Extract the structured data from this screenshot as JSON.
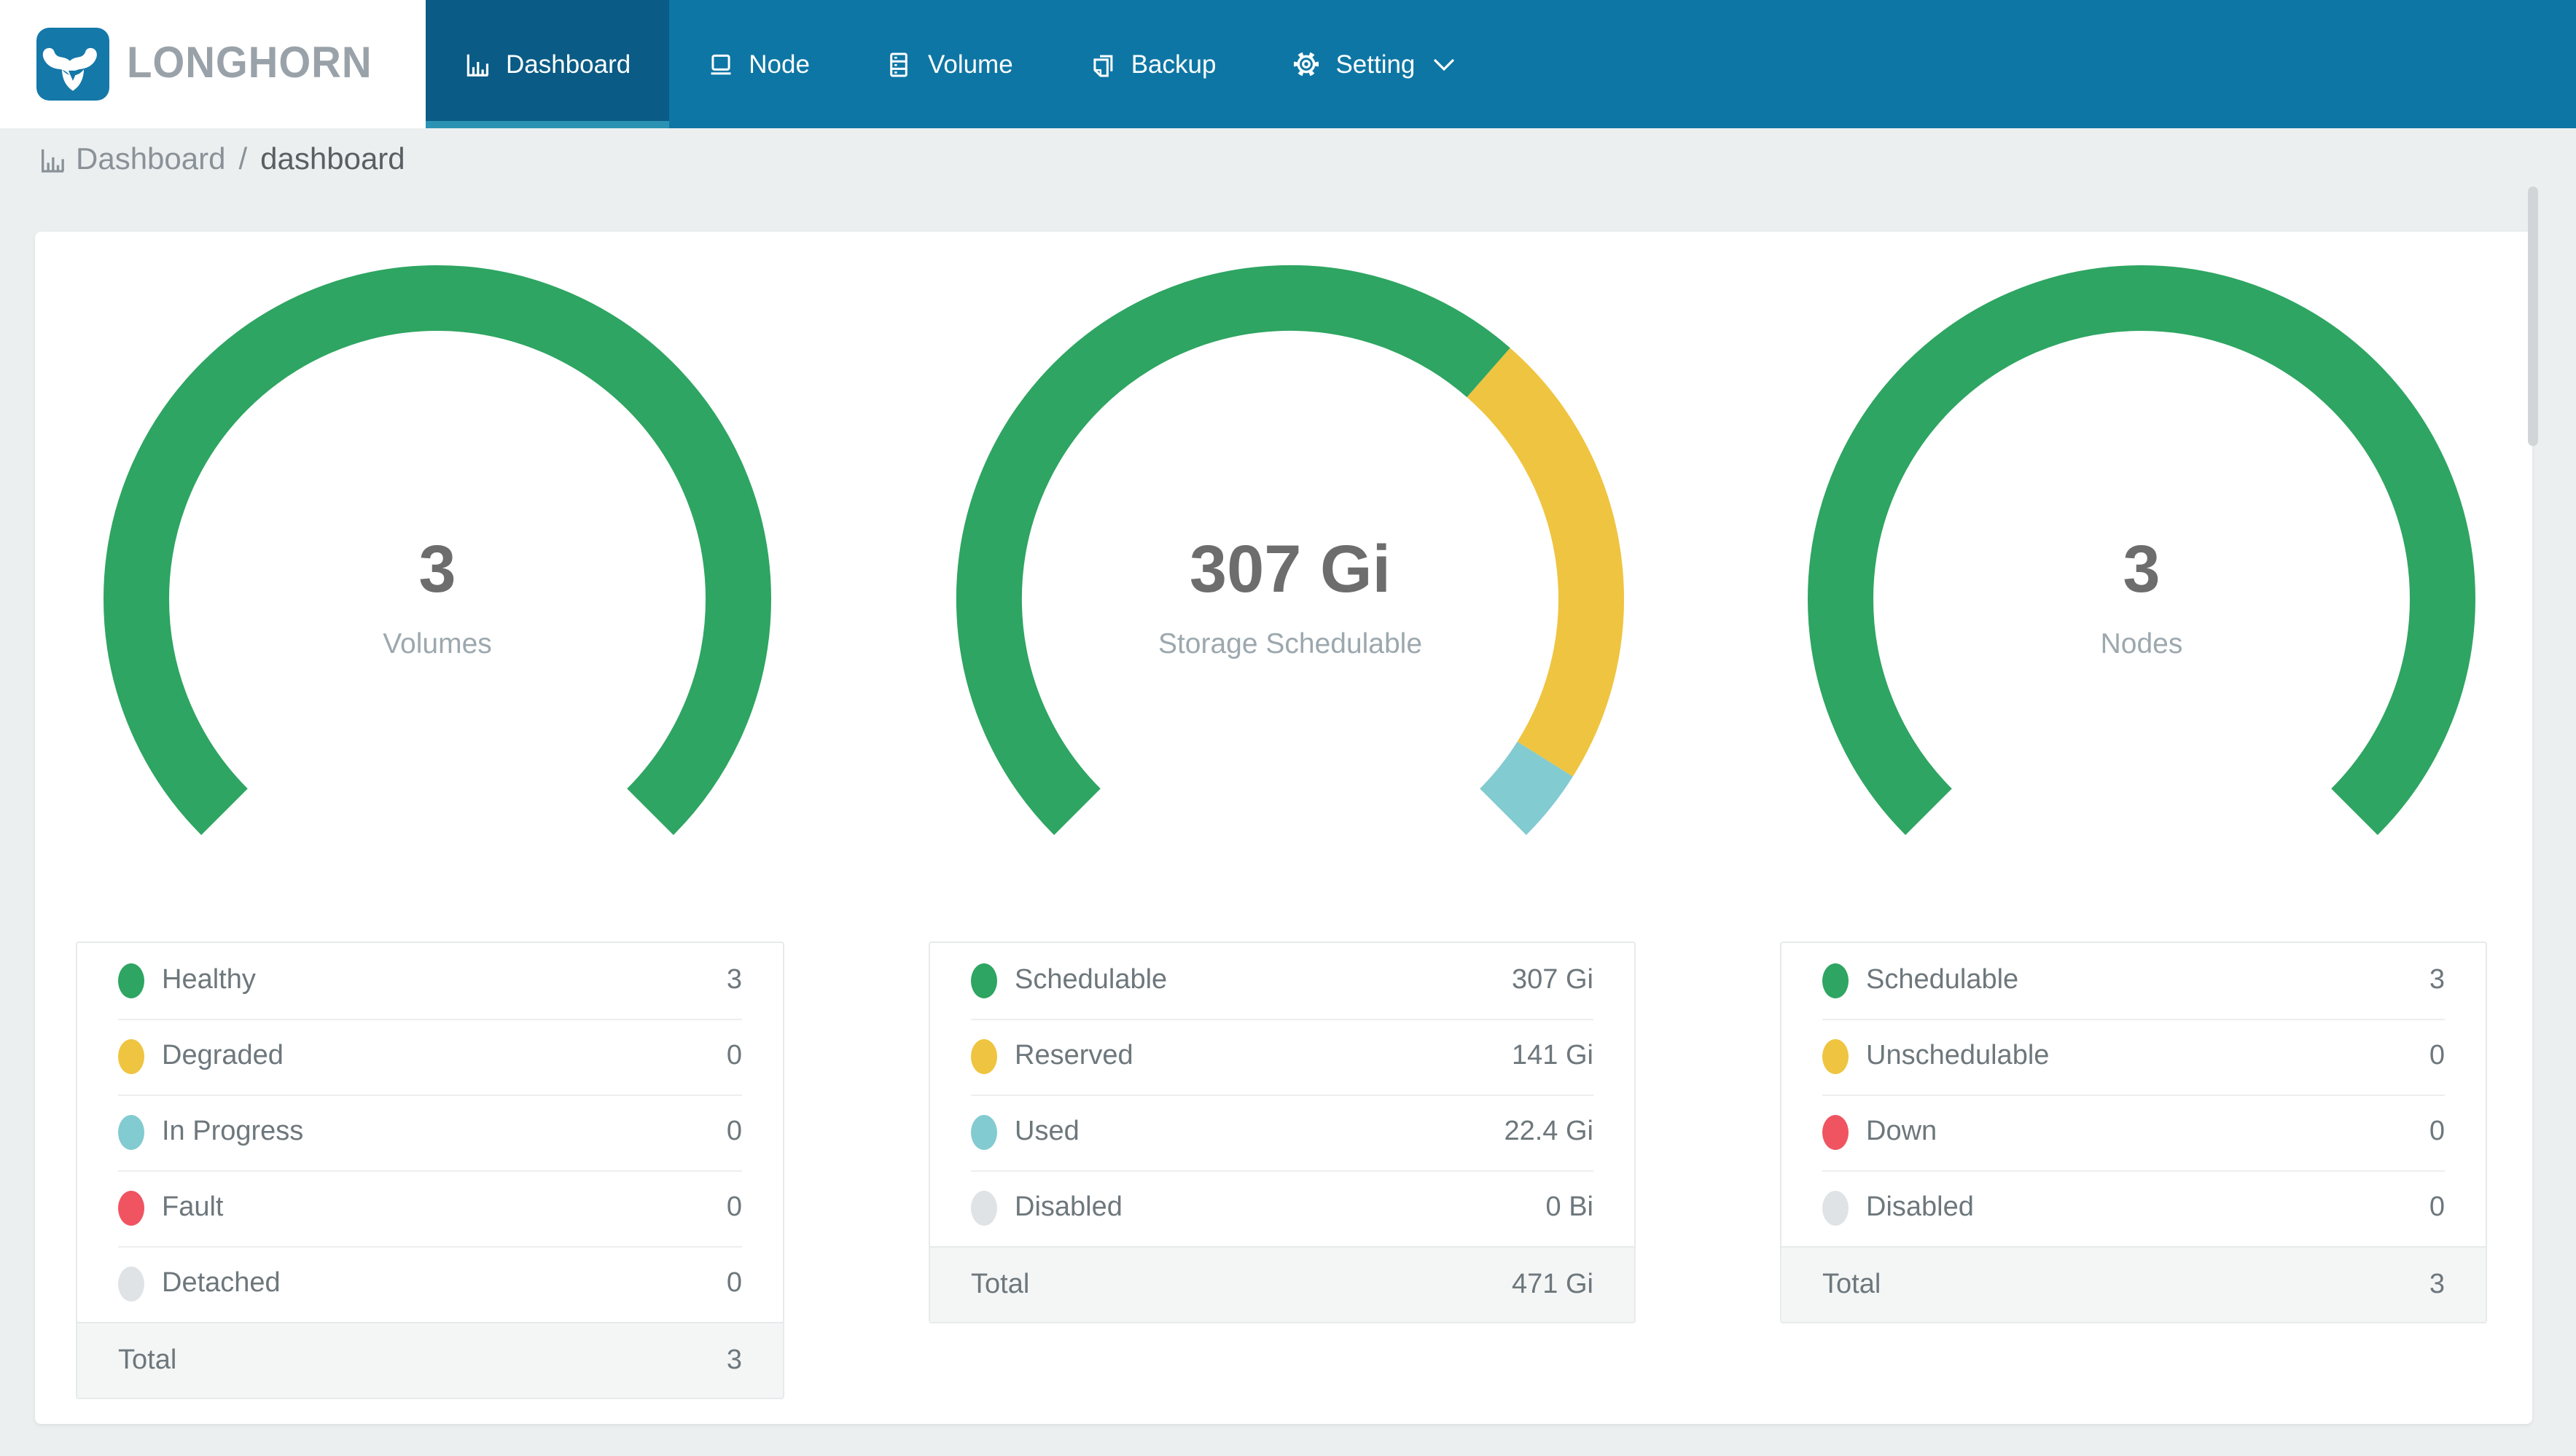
{
  "nav": {
    "brand": "LONGHORN",
    "colors": {
      "bar": "#0e76a4",
      "active_tab": "#0a5b85",
      "active_underline": "#2a93b4",
      "logo_blue": "#1478a8"
    },
    "items": [
      {
        "label": "Dashboard",
        "icon": "bar-chart-icon",
        "active": true
      },
      {
        "label": "Node",
        "icon": "laptop-icon",
        "active": false
      },
      {
        "label": "Volume",
        "icon": "storage-drawers-icon",
        "active": false
      },
      {
        "label": "Backup",
        "icon": "copy-pages-icon",
        "active": false
      },
      {
        "label": "Setting",
        "icon": "gear-icon",
        "active": false,
        "has_dropdown": true
      }
    ]
  },
  "breadcrumb": {
    "icon": "bar-chart-icon",
    "section": "Dashboard",
    "separator": "/",
    "page": "dashboard"
  },
  "chart_data": [
    {
      "type": "gauge",
      "title": "Volumes",
      "center_value": "3",
      "center_label": "Volumes",
      "start_angle": 225,
      "arc_degrees": 270,
      "segments": [
        {
          "label": "Healthy",
          "value": 3,
          "display": "3",
          "color": "#2ea562"
        },
        {
          "label": "Degraded",
          "value": 0,
          "display": "0",
          "color": "#efc440"
        },
        {
          "label": "In Progress",
          "value": 0,
          "display": "0",
          "color": "#82cbd1"
        },
        {
          "label": "Fault",
          "value": 0,
          "display": "0",
          "color": "#ef5460"
        },
        {
          "label": "Detached",
          "value": 0,
          "display": "0",
          "color": "#dfe3e6"
        }
      ],
      "total": {
        "label": "Total",
        "display": "3"
      }
    },
    {
      "type": "gauge",
      "title": "Storage Schedulable",
      "center_value": "307 Gi",
      "center_label": "Storage Schedulable",
      "start_angle": 225,
      "arc_degrees": 270,
      "segments": [
        {
          "label": "Schedulable",
          "value": 307,
          "display": "307 Gi",
          "color": "#2ea562"
        },
        {
          "label": "Reserved",
          "value": 141,
          "display": "141 Gi",
          "color": "#efc440"
        },
        {
          "label": "Used",
          "value": 22.4,
          "display": "22.4 Gi",
          "color": "#82cbd1"
        },
        {
          "label": "Disabled",
          "value": 0,
          "display": "0 Bi",
          "color": "#dfe3e6"
        }
      ],
      "total": {
        "label": "Total",
        "display": "471 Gi"
      }
    },
    {
      "type": "gauge",
      "title": "Nodes",
      "center_value": "3",
      "center_label": "Nodes",
      "start_angle": 225,
      "arc_degrees": 270,
      "segments": [
        {
          "label": "Schedulable",
          "value": 3,
          "display": "3",
          "color": "#2ea562"
        },
        {
          "label": "Unschedulable",
          "value": 0,
          "display": "0",
          "color": "#efc440"
        },
        {
          "label": "Down",
          "value": 0,
          "display": "0",
          "color": "#ef5460"
        },
        {
          "label": "Disabled",
          "value": 0,
          "display": "0",
          "color": "#dfe3e6"
        }
      ],
      "total": {
        "label": "Total",
        "display": "3"
      }
    }
  ]
}
